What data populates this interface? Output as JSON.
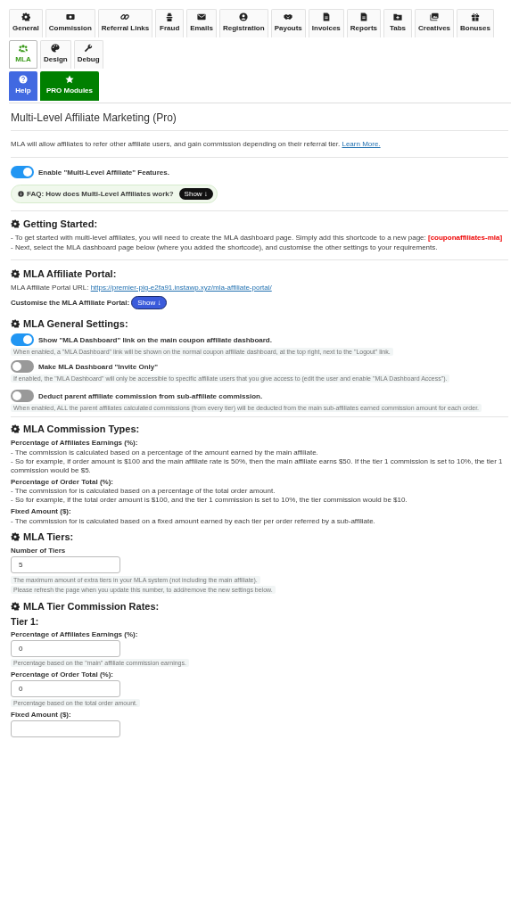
{
  "tabs": [
    {
      "label": "General",
      "selected": false
    },
    {
      "label": "Commission",
      "selected": false
    },
    {
      "label": "Referral Links",
      "selected": false
    },
    {
      "label": "Fraud",
      "selected": false
    },
    {
      "label": "Emails",
      "selected": false
    },
    {
      "label": "Registration",
      "selected": false
    },
    {
      "label": "Payouts",
      "selected": false
    },
    {
      "label": "Invoices",
      "selected": false
    },
    {
      "label": "Reports",
      "selected": false
    },
    {
      "label": "Tabs",
      "selected": false
    },
    {
      "label": "Creatives",
      "selected": false
    },
    {
      "label": "Bonuses",
      "selected": false
    },
    {
      "label": "MLA",
      "selected": true
    },
    {
      "label": "Design",
      "selected": false
    },
    {
      "label": "Debug",
      "selected": false
    }
  ],
  "extra_tabs": [
    {
      "label": "Help",
      "kind": "help"
    },
    {
      "label": "PRO Modules",
      "kind": "pro"
    }
  ],
  "page_title": "Multi-Level Affiliate Marketing (Pro)",
  "intro": {
    "text": "MLA will allow affiliates to refer other affiliate users, and gain commission depending on their referral tier.",
    "link": "Learn More."
  },
  "enable_toggle": {
    "label": "Enable \"Multi-Level Affiliate\" Features.",
    "on": true
  },
  "faq": {
    "text": "FAQ: How does Multi-Level Affiliates work?",
    "button": "Show ↓"
  },
  "getting_started": {
    "heading": "Getting Started:",
    "lines": [
      "- To get started with multi-level affiliates, you will need to create the MLA dashboard page. Simply add this shortcode to a new page: **[couponaffiliates-mla]**",
      "- Next, select the MLA dashboard page below (where you added the shortcode), and customise the other settings to your requirements."
    ]
  },
  "portal": {
    "heading": "MLA Affiliate Portal:",
    "url_label": "MLA Affiliate Portal URL:",
    "url": "https://premier-pig-e2fa91.instawp.xyz/mla-affiliate-portal/",
    "customise_label": "Customise the MLA Affiliate Portal:",
    "button": "Show ↓"
  },
  "general_settings": {
    "heading": "MLA General Settings:",
    "settings": [
      {
        "label": "Show \"MLA Dashboard\" link on the main coupon affiliate dashboard.",
        "on": true,
        "hint": "When enabled, a \"MLA Dashboard\" link will be shown on the normal coupon affiliate dashboard, at the top right, next to the \"Logout\" link."
      },
      {
        "label": "Make MLA Dashboard \"Invite Only\"",
        "on": false,
        "hint": "If enabled, the \"MLA Dashboard\" will only be accessible to specific affiliate users that you give access to (edit the user and enable \"MLA Dashboard Access\")."
      },
      {
        "label": "Deduct parent affiliate commission from sub-affiliate commission.",
        "on": false,
        "hint": "When enabled, ALL the parent affiliates calculated commissions (from every tier) will be deducted from the main sub-affiliates earned commission amount for each order."
      }
    ]
  },
  "commission_types": {
    "heading": "MLA Commission Types:",
    "types": [
      {
        "title": "Percentage of Affiliates Earnings (%):",
        "lines": [
          "- The commission is calculated based on a percentage of the amount earned by the main affiliate.",
          "- So for example, if order amount is $100 and the main affiliate rate is 50%, then the main affiliate earns $50. If the tier 1 commission is set to 10%, the tier 1 commission would be $5."
        ]
      },
      {
        "title": "Percentage of Order Total (%):",
        "lines": [
          "- The commission for is calculated based on a percentage of the total order amount.",
          "- So for example, if the total order amount is $100, and the tier 1 commission is set to 10%, the tier commission would be $10."
        ]
      },
      {
        "title": "Fixed Amount ($):",
        "lines": [
          "- The commission for is calculated based on a fixed amount earned by each tier per order referred by a sub-affiliate."
        ]
      }
    ]
  },
  "tiers": {
    "heading": "MLA Tiers:",
    "label": "Number of Tiers",
    "value": "5",
    "hints": [
      "The maximum amount of extra tiers in your MLA system (not including the main affiliate).",
      "Please refresh the page when you update this number, to add/remove the new settings below."
    ]
  },
  "tier_rates": {
    "heading": "MLA Tier Commission Rates:",
    "tier_title": "Tier 1:",
    "fields": [
      {
        "label": "Percentage of Affiliates Earnings (%):",
        "value": "0",
        "hint": "Percentage based on the \"main\" affiliate commission earnings."
      },
      {
        "label": "Percentage of Order Total (%):",
        "value": "0",
        "hint": "Percentage based on the total order amount."
      },
      {
        "label": "Fixed Amount ($):"
      }
    ]
  }
}
